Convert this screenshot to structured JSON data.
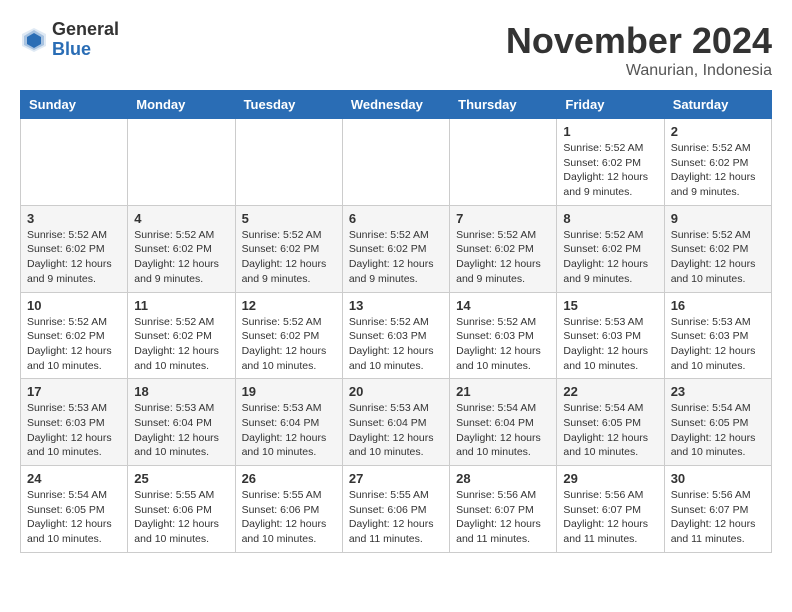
{
  "header": {
    "logo_general": "General",
    "logo_blue": "Blue",
    "month_title": "November 2024",
    "subtitle": "Wanurian, Indonesia"
  },
  "days_of_week": [
    "Sunday",
    "Monday",
    "Tuesday",
    "Wednesday",
    "Thursday",
    "Friday",
    "Saturday"
  ],
  "weeks": [
    [
      {
        "day": "",
        "info": ""
      },
      {
        "day": "",
        "info": ""
      },
      {
        "day": "",
        "info": ""
      },
      {
        "day": "",
        "info": ""
      },
      {
        "day": "",
        "info": ""
      },
      {
        "day": "1",
        "info": "Sunrise: 5:52 AM\nSunset: 6:02 PM\nDaylight: 12 hours and 9 minutes."
      },
      {
        "day": "2",
        "info": "Sunrise: 5:52 AM\nSunset: 6:02 PM\nDaylight: 12 hours and 9 minutes."
      }
    ],
    [
      {
        "day": "3",
        "info": "Sunrise: 5:52 AM\nSunset: 6:02 PM\nDaylight: 12 hours and 9 minutes."
      },
      {
        "day": "4",
        "info": "Sunrise: 5:52 AM\nSunset: 6:02 PM\nDaylight: 12 hours and 9 minutes."
      },
      {
        "day": "5",
        "info": "Sunrise: 5:52 AM\nSunset: 6:02 PM\nDaylight: 12 hours and 9 minutes."
      },
      {
        "day": "6",
        "info": "Sunrise: 5:52 AM\nSunset: 6:02 PM\nDaylight: 12 hours and 9 minutes."
      },
      {
        "day": "7",
        "info": "Sunrise: 5:52 AM\nSunset: 6:02 PM\nDaylight: 12 hours and 9 minutes."
      },
      {
        "day": "8",
        "info": "Sunrise: 5:52 AM\nSunset: 6:02 PM\nDaylight: 12 hours and 9 minutes."
      },
      {
        "day": "9",
        "info": "Sunrise: 5:52 AM\nSunset: 6:02 PM\nDaylight: 12 hours and 10 minutes."
      }
    ],
    [
      {
        "day": "10",
        "info": "Sunrise: 5:52 AM\nSunset: 6:02 PM\nDaylight: 12 hours and 10 minutes."
      },
      {
        "day": "11",
        "info": "Sunrise: 5:52 AM\nSunset: 6:02 PM\nDaylight: 12 hours and 10 minutes."
      },
      {
        "day": "12",
        "info": "Sunrise: 5:52 AM\nSunset: 6:02 PM\nDaylight: 12 hours and 10 minutes."
      },
      {
        "day": "13",
        "info": "Sunrise: 5:52 AM\nSunset: 6:03 PM\nDaylight: 12 hours and 10 minutes."
      },
      {
        "day": "14",
        "info": "Sunrise: 5:52 AM\nSunset: 6:03 PM\nDaylight: 12 hours and 10 minutes."
      },
      {
        "day": "15",
        "info": "Sunrise: 5:53 AM\nSunset: 6:03 PM\nDaylight: 12 hours and 10 minutes."
      },
      {
        "day": "16",
        "info": "Sunrise: 5:53 AM\nSunset: 6:03 PM\nDaylight: 12 hours and 10 minutes."
      }
    ],
    [
      {
        "day": "17",
        "info": "Sunrise: 5:53 AM\nSunset: 6:03 PM\nDaylight: 12 hours and 10 minutes."
      },
      {
        "day": "18",
        "info": "Sunrise: 5:53 AM\nSunset: 6:04 PM\nDaylight: 12 hours and 10 minutes."
      },
      {
        "day": "19",
        "info": "Sunrise: 5:53 AM\nSunset: 6:04 PM\nDaylight: 12 hours and 10 minutes."
      },
      {
        "day": "20",
        "info": "Sunrise: 5:53 AM\nSunset: 6:04 PM\nDaylight: 12 hours and 10 minutes."
      },
      {
        "day": "21",
        "info": "Sunrise: 5:54 AM\nSunset: 6:04 PM\nDaylight: 12 hours and 10 minutes."
      },
      {
        "day": "22",
        "info": "Sunrise: 5:54 AM\nSunset: 6:05 PM\nDaylight: 12 hours and 10 minutes."
      },
      {
        "day": "23",
        "info": "Sunrise: 5:54 AM\nSunset: 6:05 PM\nDaylight: 12 hours and 10 minutes."
      }
    ],
    [
      {
        "day": "24",
        "info": "Sunrise: 5:54 AM\nSunset: 6:05 PM\nDaylight: 12 hours and 10 minutes."
      },
      {
        "day": "25",
        "info": "Sunrise: 5:55 AM\nSunset: 6:06 PM\nDaylight: 12 hours and 10 minutes."
      },
      {
        "day": "26",
        "info": "Sunrise: 5:55 AM\nSunset: 6:06 PM\nDaylight: 12 hours and 10 minutes."
      },
      {
        "day": "27",
        "info": "Sunrise: 5:55 AM\nSunset: 6:06 PM\nDaylight: 12 hours and 11 minutes."
      },
      {
        "day": "28",
        "info": "Sunrise: 5:56 AM\nSunset: 6:07 PM\nDaylight: 12 hours and 11 minutes."
      },
      {
        "day": "29",
        "info": "Sunrise: 5:56 AM\nSunset: 6:07 PM\nDaylight: 12 hours and 11 minutes."
      },
      {
        "day": "30",
        "info": "Sunrise: 5:56 AM\nSunset: 6:07 PM\nDaylight: 12 hours and 11 minutes."
      }
    ]
  ]
}
